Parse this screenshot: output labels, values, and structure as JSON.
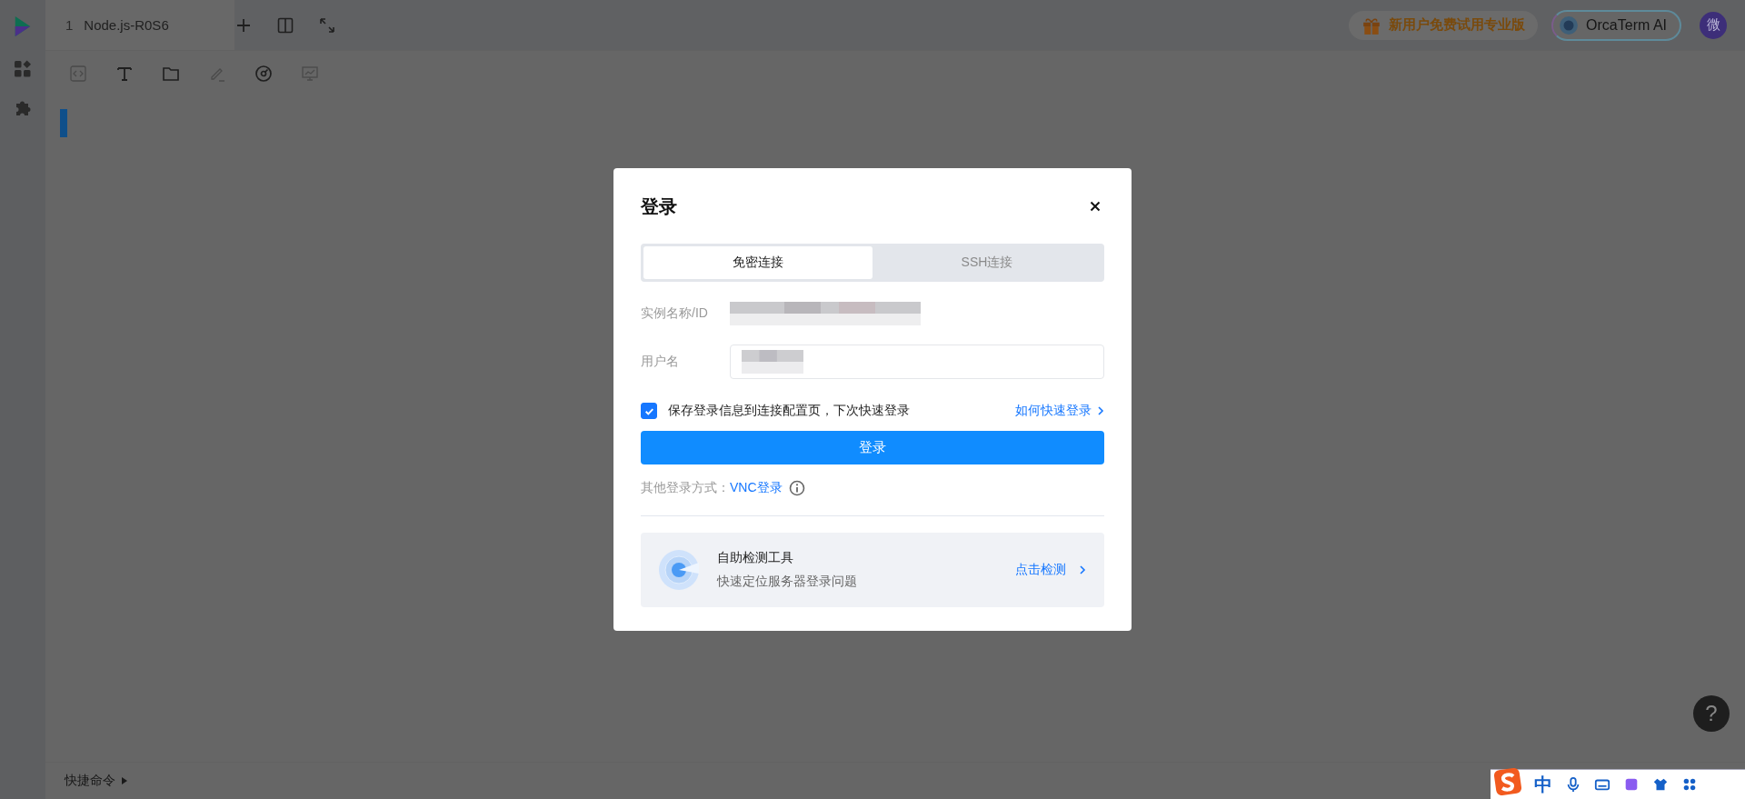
{
  "tabs": [
    {
      "number": "1",
      "label": "Node.js-R0S6",
      "selected": true
    }
  ],
  "promo": "新用户免费试用专业版",
  "ai_button": "OrcaTerm AI",
  "avatar": "微",
  "dialog": {
    "title": "登录",
    "modes": [
      {
        "label": "免密连接",
        "selected": true
      },
      {
        "label": "SSH连接",
        "selected": false
      }
    ],
    "fields": [
      {
        "label": "实例名称/ID",
        "kind": "static"
      },
      {
        "label": "用户名",
        "kind": "input"
      }
    ],
    "remember": {
      "label": "保存登录信息到连接配置页，下次快速登录",
      "checked": true
    },
    "help_link": "如何快速登录",
    "submit": "登录",
    "other": {
      "label": "其他登录方式：",
      "link": "VNC登录"
    },
    "tool": {
      "title": "自助检测工具",
      "subtitle": "快速定位服务器登录问题",
      "action": "点击检测"
    }
  },
  "quick_commands": "快捷命令",
  "help": "?",
  "ime": {
    "mode": "中"
  }
}
